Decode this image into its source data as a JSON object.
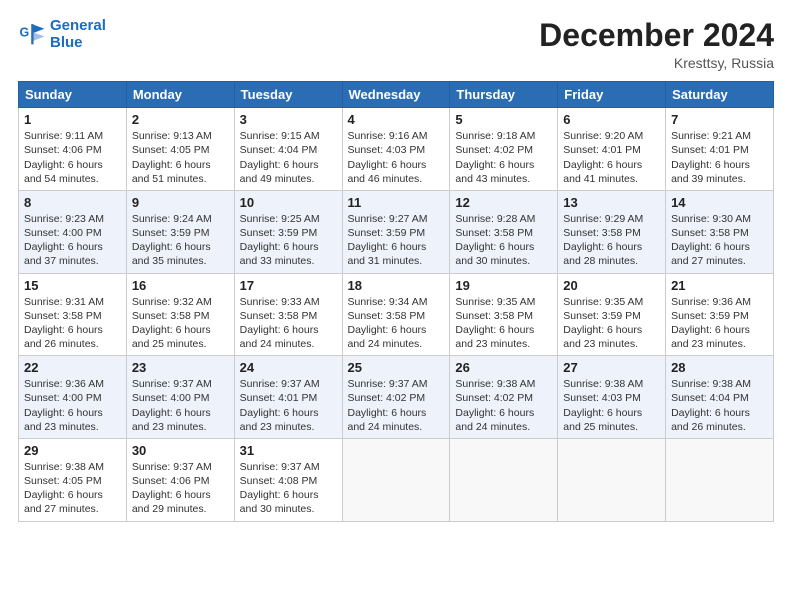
{
  "header": {
    "logo_line1": "General",
    "logo_line2": "Blue",
    "month_title": "December 2024",
    "location": "Kresttsy, Russia"
  },
  "weekdays": [
    "Sunday",
    "Monday",
    "Tuesday",
    "Wednesday",
    "Thursday",
    "Friday",
    "Saturday"
  ],
  "weeks": [
    [
      {
        "day": "1",
        "sunrise": "Sunrise: 9:11 AM",
        "sunset": "Sunset: 4:06 PM",
        "daylight": "Daylight: 6 hours and 54 minutes."
      },
      {
        "day": "2",
        "sunrise": "Sunrise: 9:13 AM",
        "sunset": "Sunset: 4:05 PM",
        "daylight": "Daylight: 6 hours and 51 minutes."
      },
      {
        "day": "3",
        "sunrise": "Sunrise: 9:15 AM",
        "sunset": "Sunset: 4:04 PM",
        "daylight": "Daylight: 6 hours and 49 minutes."
      },
      {
        "day": "4",
        "sunrise": "Sunrise: 9:16 AM",
        "sunset": "Sunset: 4:03 PM",
        "daylight": "Daylight: 6 hours and 46 minutes."
      },
      {
        "day": "5",
        "sunrise": "Sunrise: 9:18 AM",
        "sunset": "Sunset: 4:02 PM",
        "daylight": "Daylight: 6 hours and 43 minutes."
      },
      {
        "day": "6",
        "sunrise": "Sunrise: 9:20 AM",
        "sunset": "Sunset: 4:01 PM",
        "daylight": "Daylight: 6 hours and 41 minutes."
      },
      {
        "day": "7",
        "sunrise": "Sunrise: 9:21 AM",
        "sunset": "Sunset: 4:01 PM",
        "daylight": "Daylight: 6 hours and 39 minutes."
      }
    ],
    [
      {
        "day": "8",
        "sunrise": "Sunrise: 9:23 AM",
        "sunset": "Sunset: 4:00 PM",
        "daylight": "Daylight: 6 hours and 37 minutes."
      },
      {
        "day": "9",
        "sunrise": "Sunrise: 9:24 AM",
        "sunset": "Sunset: 3:59 PM",
        "daylight": "Daylight: 6 hours and 35 minutes."
      },
      {
        "day": "10",
        "sunrise": "Sunrise: 9:25 AM",
        "sunset": "Sunset: 3:59 PM",
        "daylight": "Daylight: 6 hours and 33 minutes."
      },
      {
        "day": "11",
        "sunrise": "Sunrise: 9:27 AM",
        "sunset": "Sunset: 3:59 PM",
        "daylight": "Daylight: 6 hours and 31 minutes."
      },
      {
        "day": "12",
        "sunrise": "Sunrise: 9:28 AM",
        "sunset": "Sunset: 3:58 PM",
        "daylight": "Daylight: 6 hours and 30 minutes."
      },
      {
        "day": "13",
        "sunrise": "Sunrise: 9:29 AM",
        "sunset": "Sunset: 3:58 PM",
        "daylight": "Daylight: 6 hours and 28 minutes."
      },
      {
        "day": "14",
        "sunrise": "Sunrise: 9:30 AM",
        "sunset": "Sunset: 3:58 PM",
        "daylight": "Daylight: 6 hours and 27 minutes."
      }
    ],
    [
      {
        "day": "15",
        "sunrise": "Sunrise: 9:31 AM",
        "sunset": "Sunset: 3:58 PM",
        "daylight": "Daylight: 6 hours and 26 minutes."
      },
      {
        "day": "16",
        "sunrise": "Sunrise: 9:32 AM",
        "sunset": "Sunset: 3:58 PM",
        "daylight": "Daylight: 6 hours and 25 minutes."
      },
      {
        "day": "17",
        "sunrise": "Sunrise: 9:33 AM",
        "sunset": "Sunset: 3:58 PM",
        "daylight": "Daylight: 6 hours and 24 minutes."
      },
      {
        "day": "18",
        "sunrise": "Sunrise: 9:34 AM",
        "sunset": "Sunset: 3:58 PM",
        "daylight": "Daylight: 6 hours and 24 minutes."
      },
      {
        "day": "19",
        "sunrise": "Sunrise: 9:35 AM",
        "sunset": "Sunset: 3:58 PM",
        "daylight": "Daylight: 6 hours and 23 minutes."
      },
      {
        "day": "20",
        "sunrise": "Sunrise: 9:35 AM",
        "sunset": "Sunset: 3:59 PM",
        "daylight": "Daylight: 6 hours and 23 minutes."
      },
      {
        "day": "21",
        "sunrise": "Sunrise: 9:36 AM",
        "sunset": "Sunset: 3:59 PM",
        "daylight": "Daylight: 6 hours and 23 minutes."
      }
    ],
    [
      {
        "day": "22",
        "sunrise": "Sunrise: 9:36 AM",
        "sunset": "Sunset: 4:00 PM",
        "daylight": "Daylight: 6 hours and 23 minutes."
      },
      {
        "day": "23",
        "sunrise": "Sunrise: 9:37 AM",
        "sunset": "Sunset: 4:00 PM",
        "daylight": "Daylight: 6 hours and 23 minutes."
      },
      {
        "day": "24",
        "sunrise": "Sunrise: 9:37 AM",
        "sunset": "Sunset: 4:01 PM",
        "daylight": "Daylight: 6 hours and 23 minutes."
      },
      {
        "day": "25",
        "sunrise": "Sunrise: 9:37 AM",
        "sunset": "Sunset: 4:02 PM",
        "daylight": "Daylight: 6 hours and 24 minutes."
      },
      {
        "day": "26",
        "sunrise": "Sunrise: 9:38 AM",
        "sunset": "Sunset: 4:02 PM",
        "daylight": "Daylight: 6 hours and 24 minutes."
      },
      {
        "day": "27",
        "sunrise": "Sunrise: 9:38 AM",
        "sunset": "Sunset: 4:03 PM",
        "daylight": "Daylight: 6 hours and 25 minutes."
      },
      {
        "day": "28",
        "sunrise": "Sunrise: 9:38 AM",
        "sunset": "Sunset: 4:04 PM",
        "daylight": "Daylight: 6 hours and 26 minutes."
      }
    ],
    [
      {
        "day": "29",
        "sunrise": "Sunrise: 9:38 AM",
        "sunset": "Sunset: 4:05 PM",
        "daylight": "Daylight: 6 hours and 27 minutes."
      },
      {
        "day": "30",
        "sunrise": "Sunrise: 9:37 AM",
        "sunset": "Sunset: 4:06 PM",
        "daylight": "Daylight: 6 hours and 29 minutes."
      },
      {
        "day": "31",
        "sunrise": "Sunrise: 9:37 AM",
        "sunset": "Sunset: 4:08 PM",
        "daylight": "Daylight: 6 hours and 30 minutes."
      },
      null,
      null,
      null,
      null
    ]
  ]
}
